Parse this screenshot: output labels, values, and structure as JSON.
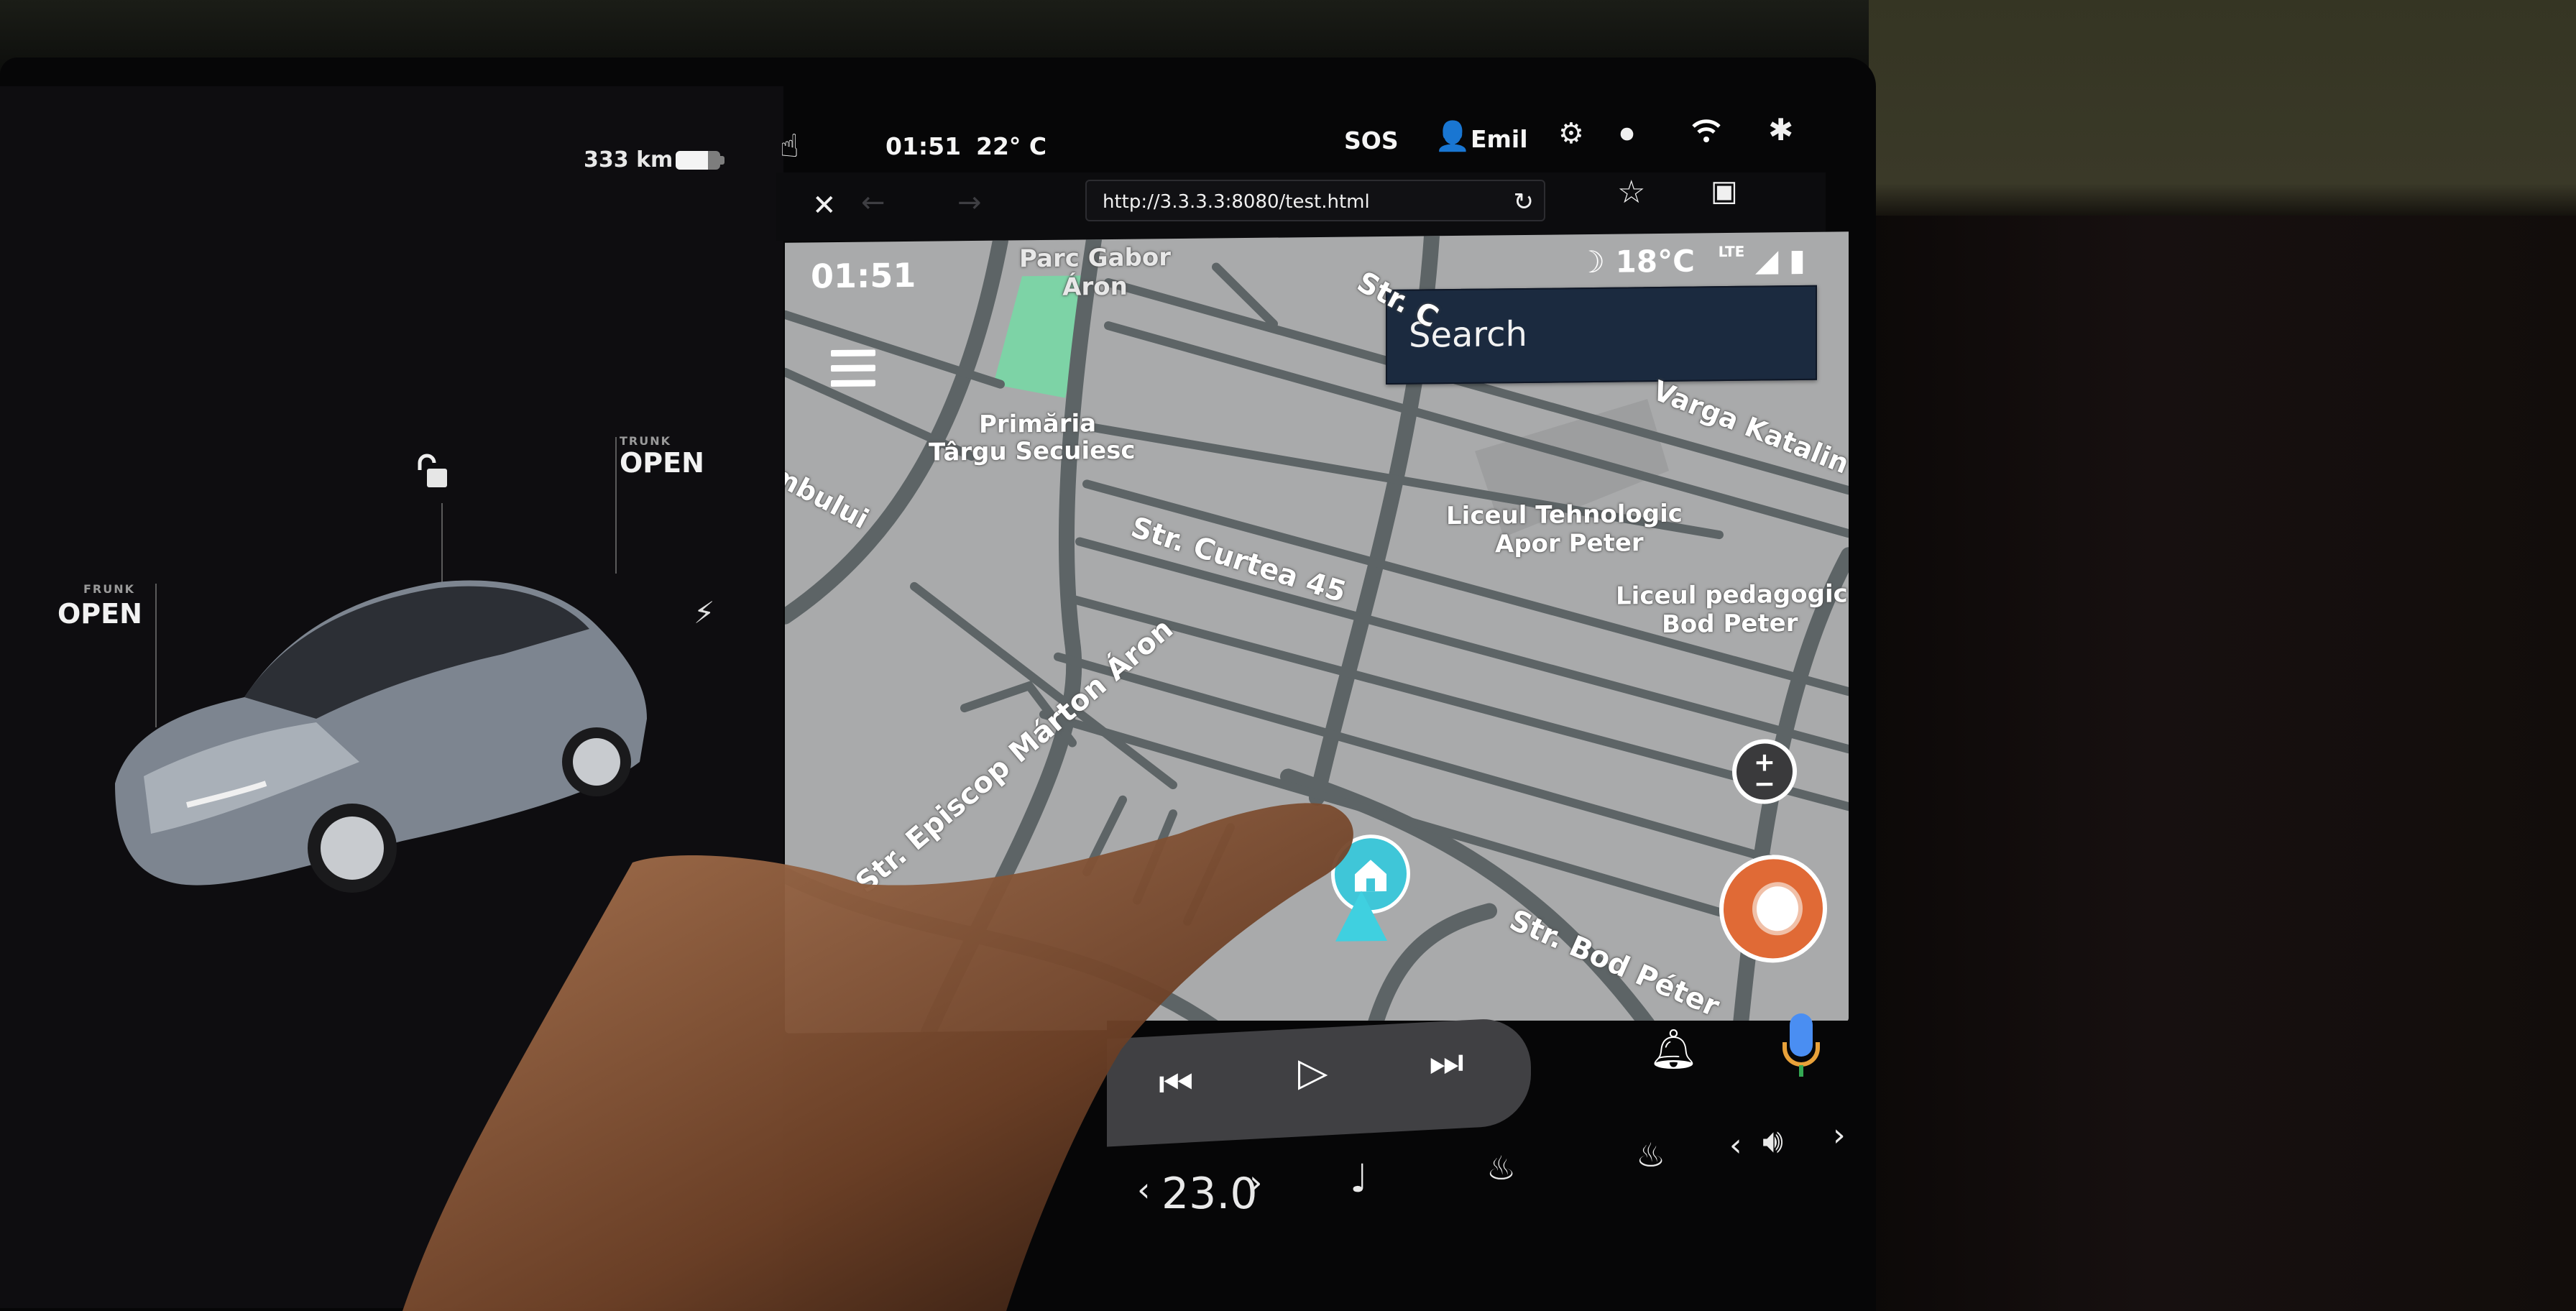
{
  "vehicle": {
    "range": "333 km",
    "battery_level_fraction": 0.72,
    "frunk": {
      "label": "FRUNK",
      "status": "OPEN"
    },
    "trunk": {
      "label": "TRUNK",
      "status": "OPEN"
    },
    "lock_state": "unlocked",
    "charge_port_icon": "lightning-bolt"
  },
  "status_bar": {
    "time": "01:51",
    "outside_temp": "22° C",
    "sos": "SOS",
    "profile_name": "Emil",
    "icons": [
      "touch-icon",
      "sos-icon",
      "profile-icon",
      "settings-icon",
      "dashcam-icon",
      "wifi-icon",
      "bluetooth-icon"
    ]
  },
  "browser": {
    "url": "http://3.3.3.3:8080/test.html",
    "close_label": "✕",
    "back_label": "←",
    "forward_label": "→",
    "reload_label": "↻",
    "bookmark_label": "☆",
    "bookmarks_folder_label": "▣"
  },
  "android_auto": {
    "time": "01:51",
    "weather_temp": "18°C",
    "weather_icon": "moon-icon",
    "network": "LTE",
    "search_placeholder": "Search",
    "map_labels": {
      "park": "Parc Gabor\nÁron",
      "primaria_1": "Primăria",
      "primaria_2": "Târgu Secuiesc",
      "street_left": "mbului",
      "street_curtea": "Str. Curtea 45",
      "street_top": "Str. C",
      "street_varga": "Varga Katalin",
      "school1_a": "Liceul Tehnologic",
      "school1_b": "Apor Peter",
      "school2_a": "Liceul pedagogic",
      "school2_b": "Bod Peter",
      "street_marton": "Str. Episcop Márton Áron",
      "street_bod": "Str. Bod Péter"
    },
    "zoom_in": "+",
    "zoom_out": "−",
    "media": {
      "prev": "⏮",
      "play": "▷",
      "next": "⏭"
    },
    "notification_icon": "bell-icon",
    "assistant_icon": "mic-icon"
  },
  "climate": {
    "temperature": "23.0",
    "temp_decrease": "‹",
    "temp_increase": "›",
    "volume_decrease": "‹",
    "volume_increase": "›"
  }
}
